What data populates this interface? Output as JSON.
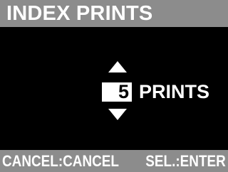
{
  "screen": {
    "title": "INDEX PRINTS",
    "print_count": "5",
    "print_unit": "PRINTS",
    "increment_icon": "triangle-up",
    "decrement_icon": "triangle-down"
  },
  "footer": {
    "cancel_hint": "CANCEL:CANCEL",
    "select_hint": "SEL.:ENTER"
  },
  "colors": {
    "background": "#000000",
    "bar": "#8c8c8c",
    "text": "#ffffff",
    "value_box": "#ffffff",
    "value_text": "#000000"
  }
}
